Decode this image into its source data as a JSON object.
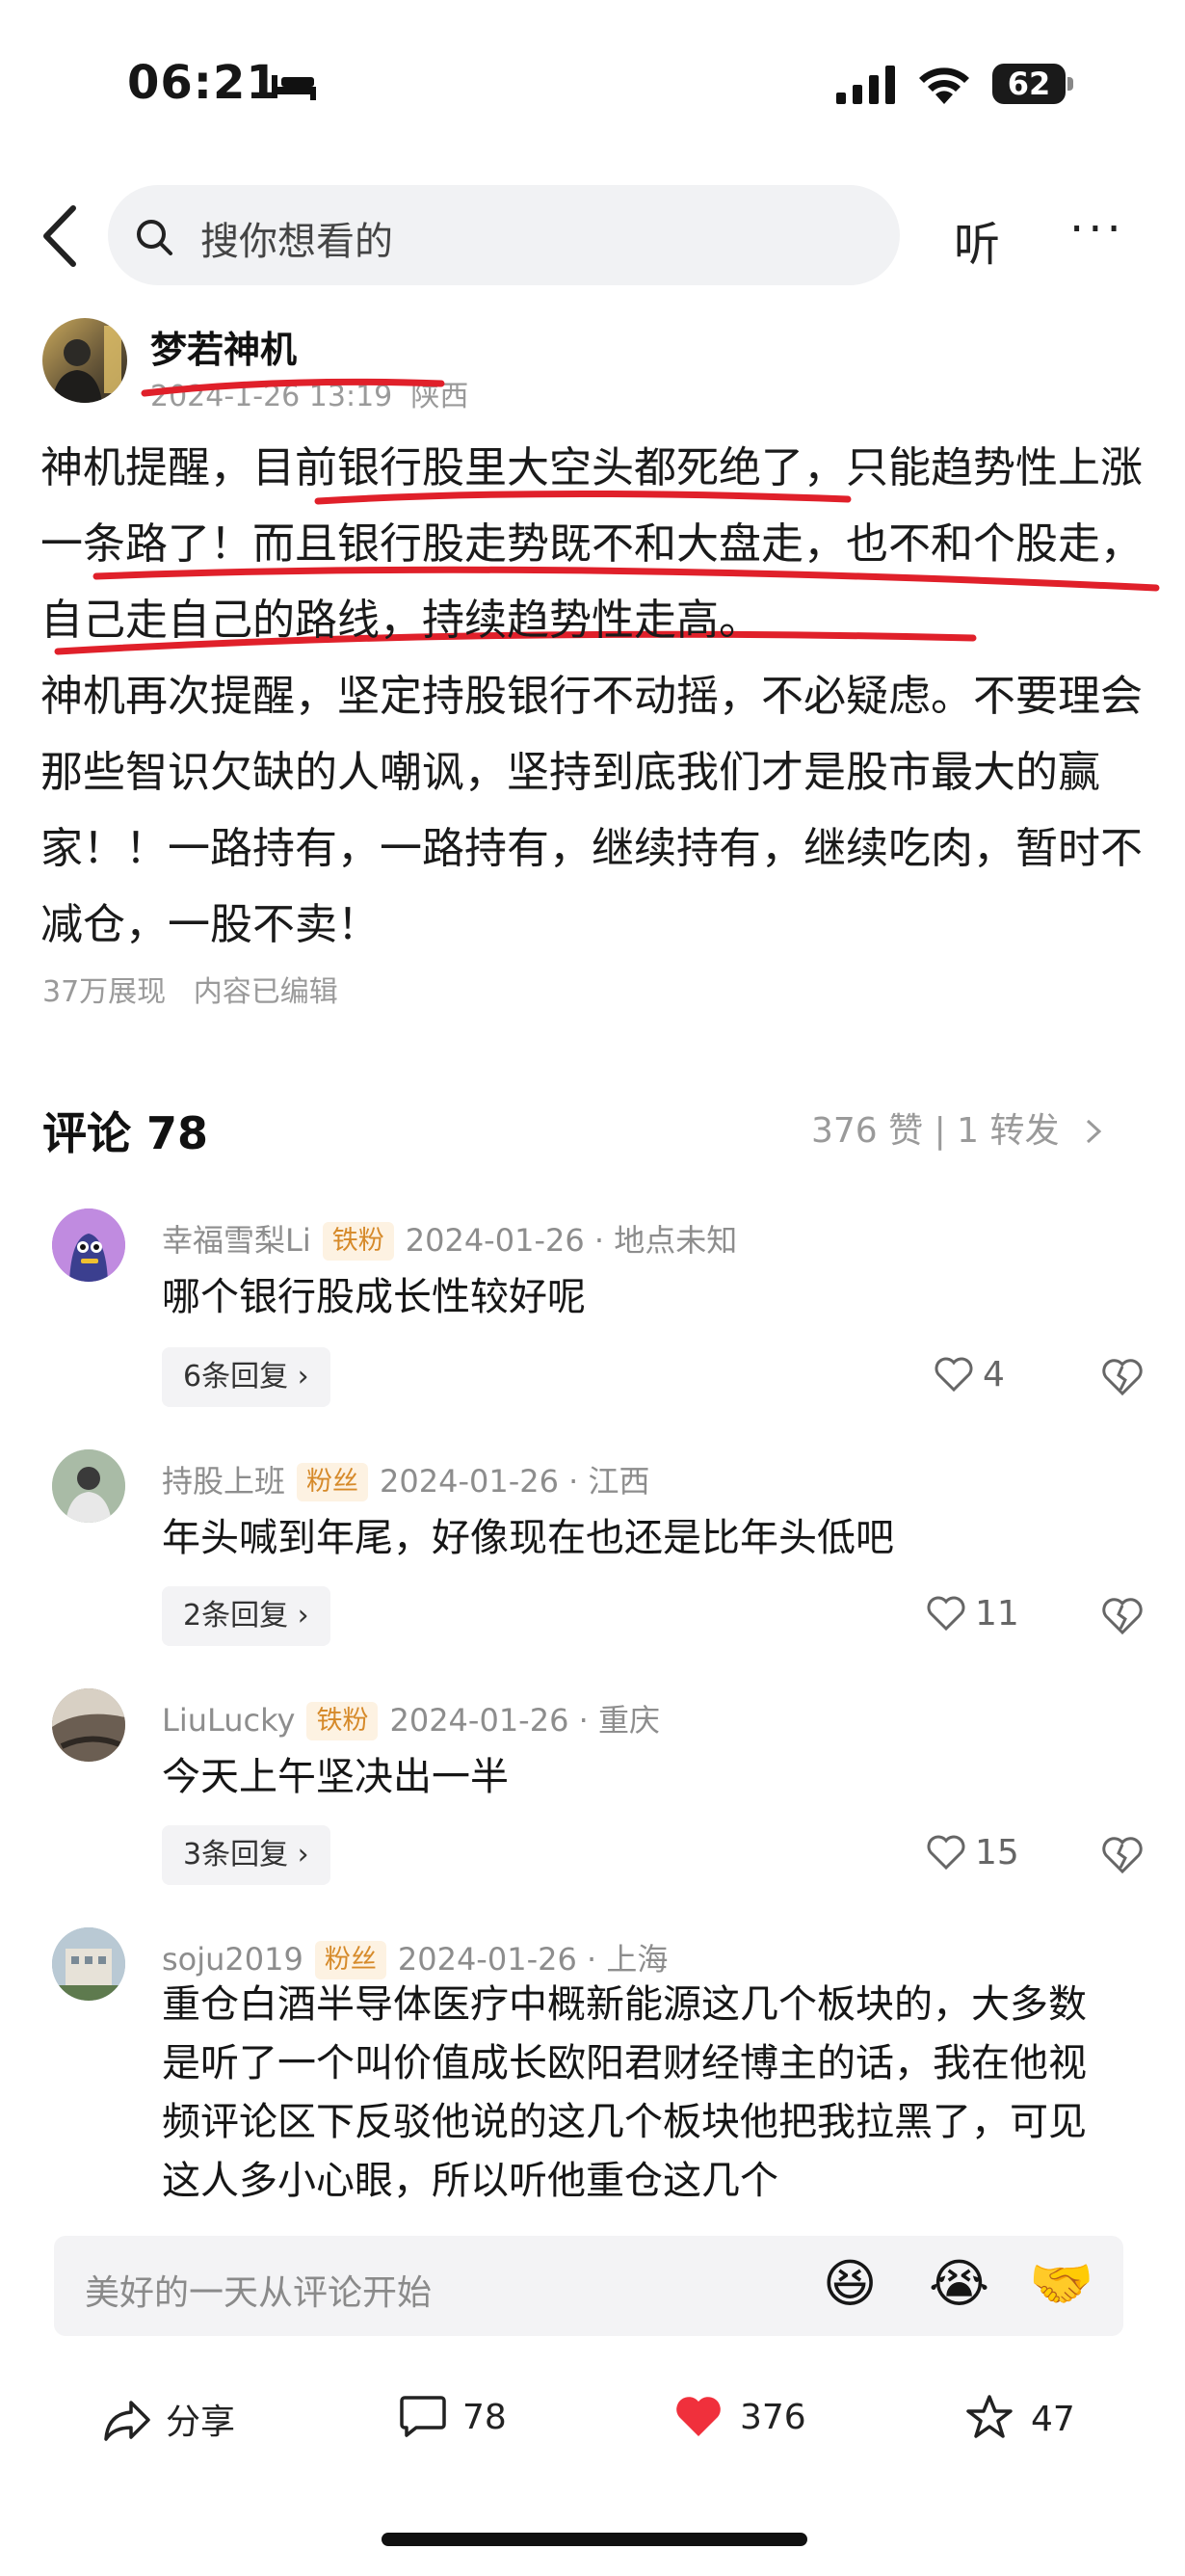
{
  "status_bar": {
    "time": "06:21",
    "battery": "62"
  },
  "nav": {
    "search_placeholder": "搜你想看的",
    "listen_label": "听",
    "more_label": "···"
  },
  "post": {
    "author": "梦若神机",
    "date": "2024-1-26 13:19",
    "location": "陕西",
    "paragraph1": "神机提醒，目前银行股里大空头都死绝了，只能趋势性上涨一条路了！而且银行股走势既不和大盘走，也不和个股走，自己走自己的路线，持续趋势性走高。",
    "paragraph2": "神机再次提醒，坚定持股银行不动摇，不必疑虑。不要理会那些智识欠缺的人嘲讽，坚持到底我们才是股市最大的赢家！！一路持有，一路持有，继续持有，继续吃肉，暂时不减仓，一股不卖！",
    "views": "37万展现",
    "edited": "内容已编辑"
  },
  "comments_header": {
    "title": "评论 78",
    "stats": "376 赞 | 1 转发"
  },
  "comments": [
    {
      "user": "幸福雪梨Li",
      "badge": "铁粉",
      "meta": "2024-01-26 · 地点未知",
      "text": "哪个银行股成长性较好呢",
      "replies": "6条回复",
      "likes": "4"
    },
    {
      "user": "持股上班",
      "badge": "粉丝",
      "meta": "2024-01-26 · 江西",
      "text": "年头喊到年尾，好像现在也还是比年头低吧",
      "replies": "2条回复",
      "likes": "11"
    },
    {
      "user": "LiuLucky",
      "badge": "铁粉",
      "meta": "2024-01-26 · 重庆",
      "text": "今天上午坚决出一半",
      "replies": "3条回复",
      "likes": "15"
    },
    {
      "user": "soju2019",
      "badge": "粉丝",
      "meta": "2024-01-26 · 上海",
      "text": "重仓白酒半导体医疗中概新能源这几个板块的，大多数是听了一个叫价值成长欧阳君财经博主的话，我在他视频评论区下反驳他说的这几个板块他把我拉黑了，可见这人多小心眼，所以听他重仓这几个"
    }
  ],
  "comment_bar": {
    "placeholder": "美好的一天从评论开始",
    "emojis": [
      "😆",
      "😭",
      "🤝"
    ]
  },
  "actions": {
    "share": "分享",
    "comments": "78",
    "likes": "376",
    "favorites": "47"
  },
  "colors": {
    "annotation_red": "#e0202a",
    "badge_bg": "#fdf2e2",
    "badge_text": "#d68a2a",
    "like_red": "#f0303c"
  }
}
